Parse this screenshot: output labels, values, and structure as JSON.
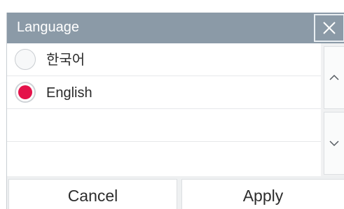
{
  "dialog": {
    "title": "Language",
    "close_icon": "close-icon",
    "options": [
      {
        "label": "한국어",
        "selected": false
      },
      {
        "label": "English",
        "selected": true
      }
    ],
    "scroll_up_icon": "chevron-up-icon",
    "scroll_down_icon": "chevron-down-icon",
    "buttons": {
      "cancel": "Cancel",
      "apply": "Apply"
    }
  },
  "colors": {
    "title_bar": "#8b9aa7",
    "selected_radio": "#e4124a",
    "background": "#ffffff"
  }
}
